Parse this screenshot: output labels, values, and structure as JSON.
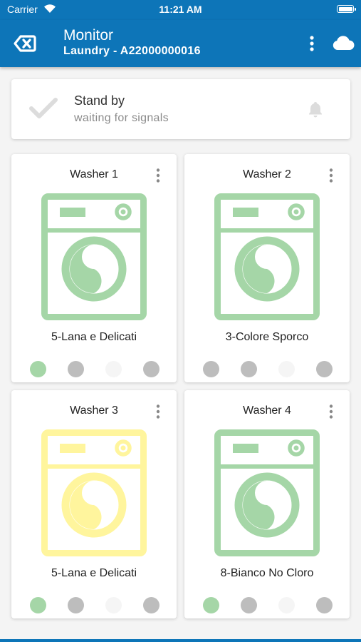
{
  "status_bar": {
    "carrier": "Carrier",
    "time": "11:21 AM"
  },
  "header": {
    "title": "Monitor",
    "subtitle": "Laundry - A22000000016"
  },
  "status": {
    "title": "Stand by",
    "subtitle": "waiting for signals"
  },
  "colors": {
    "primary": "#0d75b8",
    "washer_green": "#a5d6a7",
    "washer_yellow": "#fff59d",
    "dot_green": "#a5d6a7",
    "dot_gray": "#bdbdbd",
    "dot_light": "#f5f5f5"
  },
  "washers": [
    {
      "name": "Washer 1",
      "program": "5-Lana e Delicati",
      "state_color": "green",
      "indicators": [
        "green",
        "gray",
        "light",
        "gray"
      ]
    },
    {
      "name": "Washer 2",
      "program": "3-Colore Sporco",
      "state_color": "green",
      "indicators": [
        "gray",
        "gray",
        "light",
        "gray"
      ]
    },
    {
      "name": "Washer 3",
      "program": "5-Lana e Delicati",
      "state_color": "yellow",
      "indicators": [
        "green",
        "gray",
        "light",
        "gray"
      ]
    },
    {
      "name": "Washer 4",
      "program": "8-Bianco No Cloro",
      "state_color": "green",
      "indicators": [
        "green",
        "gray",
        "light",
        "gray"
      ]
    }
  ]
}
